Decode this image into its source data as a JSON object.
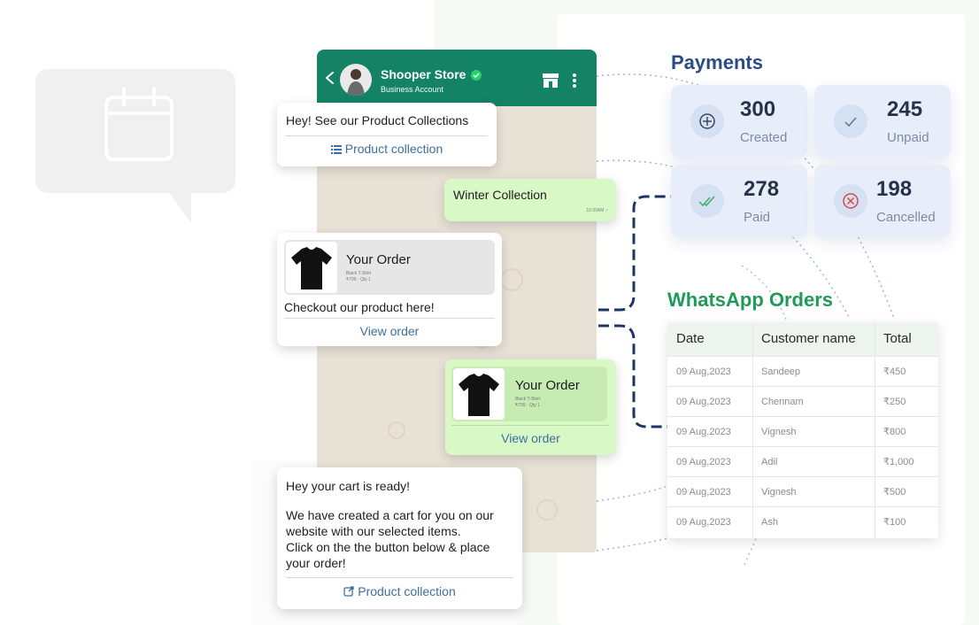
{
  "chat": {
    "store_name": "Shooper Store",
    "account_type": "Business Account",
    "messages": {
      "m1_text": "Hey! See our Product Collections",
      "m1_link": "Product collection",
      "m2_text": "Winter Collection",
      "m2_time": "10:30AM",
      "m3_title": "Your Order",
      "m3_sub1": "Black T-Shirt",
      "m3_sub2": "₹799 · Qty 1",
      "m3_text": "Checkout our product here!",
      "m3_link": "View order",
      "m4_title": "Your Order",
      "m4_sub1": "Black T-Shirt",
      "m4_sub2": "₹799 · Qty 1",
      "m4_link": "View order",
      "m5_line1": "Hey your cart is ready!",
      "m5_line2": "We have created a cart for you on our",
      "m5_line3": "website with our selected items.",
      "m5_line4": "Click on the the button below & place",
      "m5_line5": "your order!",
      "m5_link": "Product collection"
    }
  },
  "payments": {
    "title": "Payments",
    "stats": [
      {
        "value": "300",
        "label": "Created",
        "icon": "plus-circle-icon"
      },
      {
        "value": "245",
        "label": "Unpaid",
        "icon": "check-icon"
      },
      {
        "value": "278",
        "label": "Paid",
        "icon": "double-check-icon"
      },
      {
        "value": "198",
        "label": "Cancelled",
        "icon": "x-circle-icon"
      }
    ]
  },
  "orders": {
    "title": "WhatsApp Orders",
    "columns": [
      "Date",
      "Customer name",
      "Total"
    ],
    "rows": [
      [
        "09 Aug,2023",
        "Sandeep",
        "₹450"
      ],
      [
        "09 Aug,2023",
        "Chennam",
        "₹250"
      ],
      [
        "09 Aug,2023",
        "Vignesh",
        "₹800"
      ],
      [
        "09 Aug,2023",
        "Adil",
        "₹1,000"
      ],
      [
        "09 Aug,2023",
        "Vignesh",
        "₹500"
      ],
      [
        "09 Aug,2023",
        "Ash",
        "₹100"
      ]
    ]
  },
  "colors": {
    "whatsapp_green": "#138265",
    "payments_blue": "#2b4b86",
    "orders_green": "#1f9b57",
    "link_blue": "#3d6fa0"
  }
}
